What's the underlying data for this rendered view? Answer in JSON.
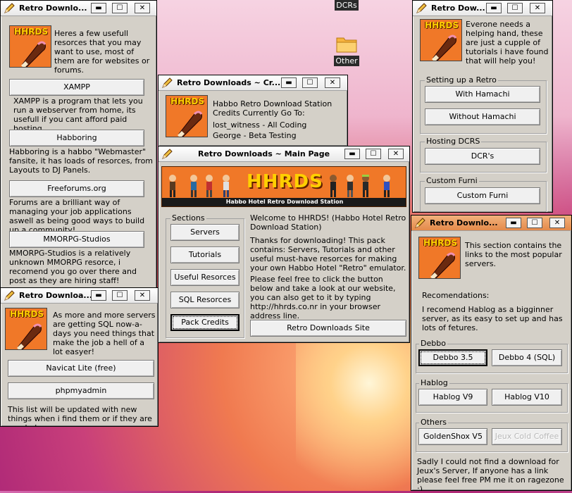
{
  "desktop": {
    "icons": [
      {
        "label": "DCRs"
      },
      {
        "label": "Other"
      }
    ]
  },
  "logo_text": "HHRDS",
  "window_buttons": {
    "minimize": "▬",
    "maximize": "☐",
    "close": "✕"
  },
  "win_resources": {
    "title": "Retro Downlo...",
    "intro": "Heres a few usefull resorces that you may want to use, most of them are for websites or forums.",
    "items": [
      {
        "button": "XAMPP",
        "desc": "XAMPP is a program that lets you run a webserver from home, its usefull if you cant afford paid hosting."
      },
      {
        "button": "Habboring",
        "desc": "Habboring is a habbo \"Webmaster\" fansite, it has loads of resorces, from Layouts to DJ Panels."
      },
      {
        "button": "Freeforums.org",
        "desc": "Forums are a brilliant way of managing your job applications aswell as being good ways to build up a community!"
      },
      {
        "button": "MMORPG-Studios",
        "desc": "MMORPG-Studios is a relatively unknown MMORPG resorce, i recomend you go over there and post as they are hiring staff!"
      }
    ]
  },
  "win_sql": {
    "title": "Retro Downloa...",
    "intro": "As more and more servers are getting SQL now-a-days you need things that make the job a hell of a lot easyer!",
    "buttons": [
      "Navicat Lite (free)",
      "phpmyadmin"
    ],
    "footer": "This list will be updated with new things when i find them or if they are needed."
  },
  "win_credits": {
    "title": "Retro Downloads ~ Cr...",
    "line1": "Habbo Retro Download Station",
    "line2": "Credits Currently Go To:",
    "line3": "lost_witness -  All Coding",
    "line4": "George - Beta Testing"
  },
  "win_main": {
    "title": "Retro Downloads ~ Main Page",
    "banner_text": "HHRDS",
    "banner_sub": "Habbo Hotel Retro Download Station",
    "sections_label": "Sections",
    "sections": [
      "Servers",
      "Tutorials",
      "Useful Resorces",
      "SQL Resorces",
      "Pack Credits"
    ],
    "p1": "Welcome to HHRDS! (Habbo Hotel Retro Download Station)",
    "p2": "Thanks for downloading! This pack contains: Servers, Tutorials and other useful must-have resorces for making your own Habbo Hotel \"Retro\" emulator.",
    "p3": "Please feel free to click the button below and take a look at our website, you can also get to it by typing http://hhrds.co.nr in your browser address line.",
    "site_button": "Retro Downloads Site"
  },
  "win_tutorials": {
    "title": "Retro Dow...",
    "intro": "Everone needs a helping hand, these are just a cupple of tutorials i have found that will help you!",
    "group1_label": "Setting up a Retro",
    "group1_buttons": [
      "With Hamachi",
      "Without Hamachi"
    ],
    "group2_label": "Hosting DCRS",
    "group2_buttons": [
      "DCR's"
    ],
    "group3_label": "Custom Furni",
    "group3_buttons": [
      "Custom Furni"
    ]
  },
  "win_servers": {
    "title": "Retro Downlo...",
    "intro": "This section contains the links to the most popular servers.",
    "rec_label": "Recomendations:",
    "rec_text": "I recomend Hablog as a bigginner server, as its easy to set up and has lots of fetures.",
    "debbo_label": "Debbo",
    "debbo_buttons": [
      "Debbo 3.5",
      "Debbo 4 (SQL)"
    ],
    "hablog_label": "Hablog",
    "hablog_buttons": [
      "Hablog V9",
      "Hablog V10"
    ],
    "others_label": "Others",
    "others_buttons": [
      "GoldenShox V5",
      "Jeux Cold Coffee"
    ],
    "footer": "Sadly I could not find a download for Jeux's Server, If anyone has a link please feel free PM me it on ragezone :)"
  },
  "colors": {
    "logo_orange": "#f07828",
    "logo_yellow": "#ffd000",
    "window_gray": "#d4d0c8"
  }
}
